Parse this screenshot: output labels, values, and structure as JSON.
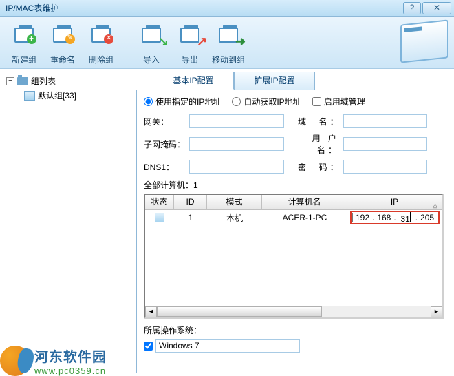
{
  "window": {
    "title": "IP/MAC表维护"
  },
  "toolbar": {
    "new_group": "新建组",
    "rename": "重命名",
    "delete_group": "删除组",
    "import": "导入",
    "export": "导出",
    "move_to_group": "移动到组"
  },
  "sidebar": {
    "root_label": "组列表",
    "default_group": "默认组[33]"
  },
  "tabs": {
    "basic": "基本IP配置",
    "extended": "扩展IP配置"
  },
  "radios": {
    "use_specified": "使用指定的IP地址",
    "auto_obtain": "自动获取IP地址",
    "enable_domain": "启用域管理"
  },
  "form": {
    "gateway_label": "网关：",
    "gateway_value": "",
    "domain_label": "域 名：",
    "domain_value": "",
    "subnet_label": "子网掩码：",
    "subnet_value": "",
    "user_label": "用 户 名：",
    "user_value": "",
    "dns_label": "DNS1：",
    "dns_value": "",
    "password_label": "密 码：",
    "password_value": ""
  },
  "count_label": "全部计算机：1",
  "grid": {
    "headers": {
      "status": "状态",
      "id": "ID",
      "mode": "模式",
      "name": "计算机名",
      "ip": "IP"
    },
    "row": {
      "id": "1",
      "mode": "本机",
      "name": "ACER-1-PC",
      "ip_o1": "192",
      "ip_o2": "168",
      "ip_o3": "31",
      "ip_o4": "205"
    }
  },
  "os": {
    "label": "所属操作系统：",
    "value": "Windows 7"
  },
  "watermark": {
    "name": "河东软件园",
    "url": "www.pc0359.cn"
  }
}
